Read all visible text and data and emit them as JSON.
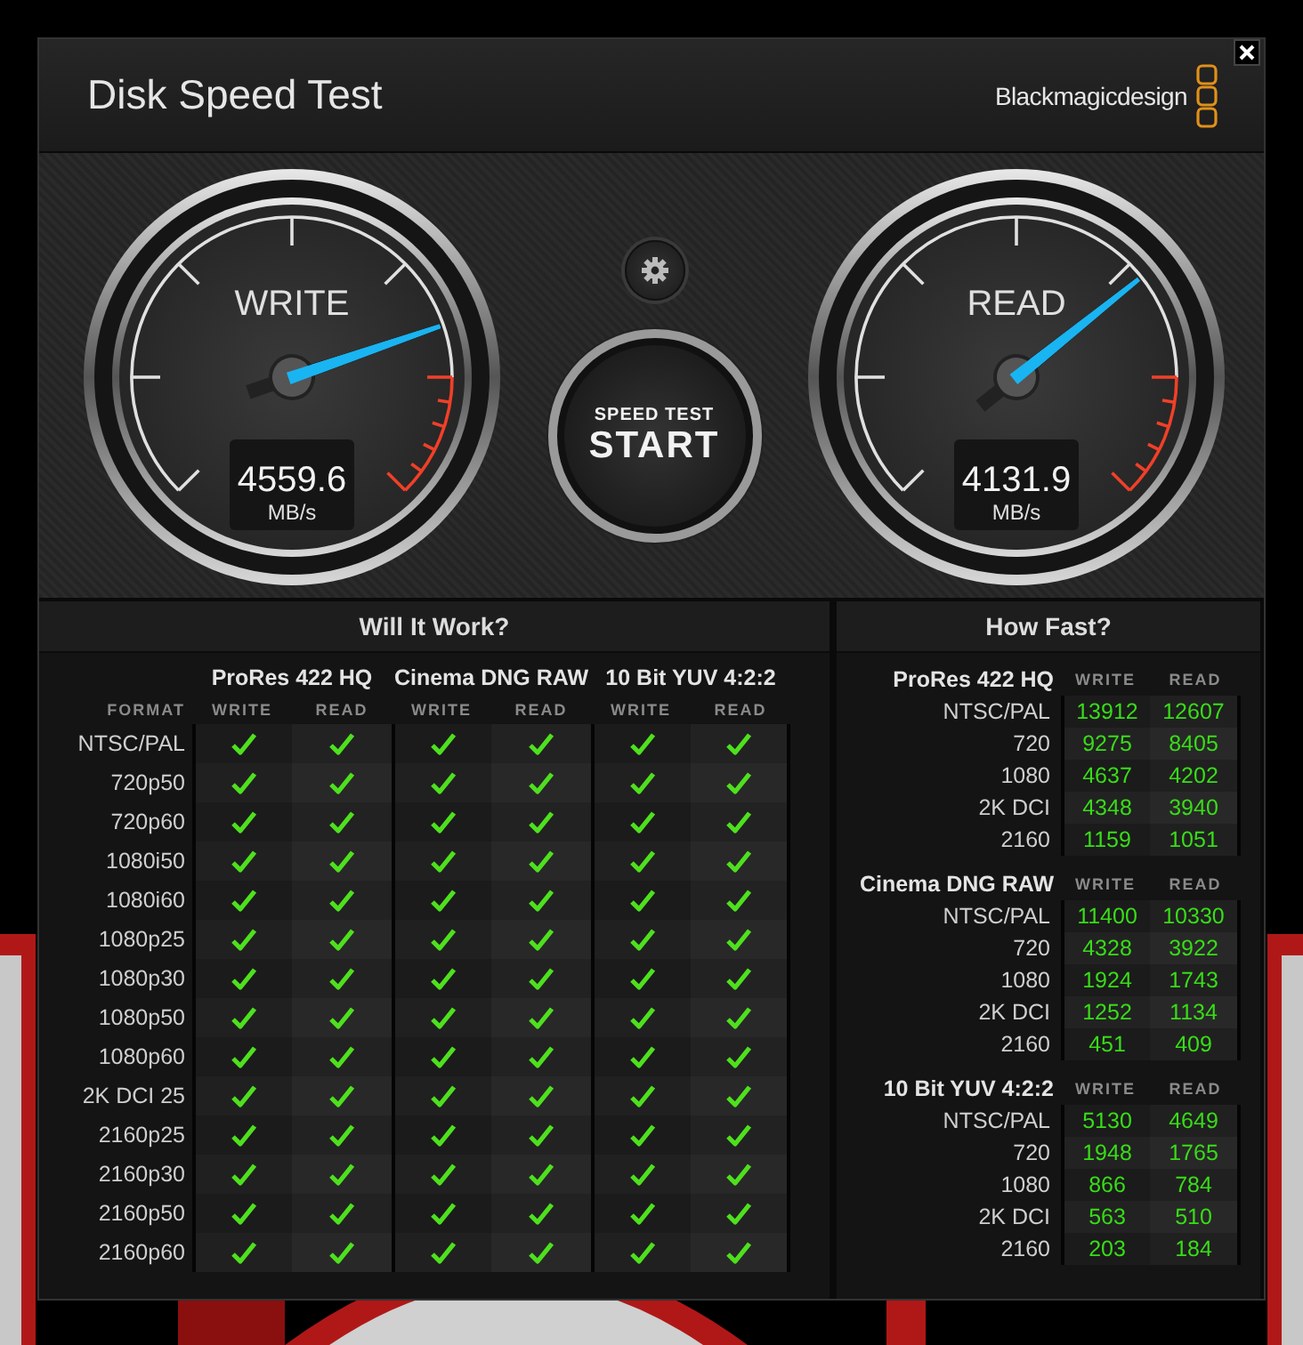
{
  "window": {
    "title": "Disk Speed Test",
    "brand": "Blackmagicdesign"
  },
  "gauges": [
    {
      "label": "WRITE",
      "value": "4559.6",
      "unit": "MB/s",
      "level": 0.763
    },
    {
      "label": "READ",
      "value": "4131.9",
      "unit": "MB/s",
      "level": 0.69
    }
  ],
  "start_button": {
    "caption": "SPEED TEST",
    "label": "START"
  },
  "will_it_work": {
    "title": "Will It Work?",
    "format_label": "FORMAT",
    "groups": [
      {
        "name": "ProRes 422 HQ",
        "columns": [
          "WRITE",
          "READ"
        ]
      },
      {
        "name": "Cinema DNG RAW",
        "columns": [
          "WRITE",
          "READ"
        ]
      },
      {
        "name": "10 Bit YUV 4:2:2",
        "columns": [
          "WRITE",
          "READ"
        ]
      }
    ],
    "rows": [
      {
        "format": "NTSC/PAL",
        "results": [
          {
            "checked": true
          },
          {
            "checked": true
          },
          {
            "checked": true
          },
          {
            "checked": true
          },
          {
            "checked": true
          },
          {
            "checked": true
          }
        ]
      },
      {
        "format": "720p50",
        "results": [
          {
            "checked": true
          },
          {
            "checked": true
          },
          {
            "checked": true
          },
          {
            "checked": true
          },
          {
            "checked": true
          },
          {
            "checked": true
          }
        ]
      },
      {
        "format": "720p60",
        "results": [
          {
            "checked": true
          },
          {
            "checked": true
          },
          {
            "checked": true
          },
          {
            "checked": true
          },
          {
            "checked": true
          },
          {
            "checked": true
          }
        ]
      },
      {
        "format": "1080i50",
        "results": [
          {
            "checked": true
          },
          {
            "checked": true
          },
          {
            "checked": true
          },
          {
            "checked": true
          },
          {
            "checked": true
          },
          {
            "checked": true
          }
        ]
      },
      {
        "format": "1080i60",
        "results": [
          {
            "checked": true
          },
          {
            "checked": true
          },
          {
            "checked": true
          },
          {
            "checked": true
          },
          {
            "checked": true
          },
          {
            "checked": true
          }
        ]
      },
      {
        "format": "1080p25",
        "results": [
          {
            "checked": true
          },
          {
            "checked": true
          },
          {
            "checked": true
          },
          {
            "checked": true
          },
          {
            "checked": true
          },
          {
            "checked": true
          }
        ]
      },
      {
        "format": "1080p30",
        "results": [
          {
            "checked": true
          },
          {
            "checked": true
          },
          {
            "checked": true
          },
          {
            "checked": true
          },
          {
            "checked": true
          },
          {
            "checked": true
          }
        ]
      },
      {
        "format": "1080p50",
        "results": [
          {
            "checked": true
          },
          {
            "checked": true
          },
          {
            "checked": true
          },
          {
            "checked": true
          },
          {
            "checked": true
          },
          {
            "checked": true
          }
        ]
      },
      {
        "format": "1080p60",
        "results": [
          {
            "checked": true
          },
          {
            "checked": true
          },
          {
            "checked": true
          },
          {
            "checked": true
          },
          {
            "checked": true
          },
          {
            "checked": true
          }
        ]
      },
      {
        "format": "2K DCI 25",
        "results": [
          {
            "checked": true
          },
          {
            "checked": true
          },
          {
            "checked": true
          },
          {
            "checked": true
          },
          {
            "checked": true
          },
          {
            "checked": true
          }
        ]
      },
      {
        "format": "2160p25",
        "results": [
          {
            "checked": true
          },
          {
            "checked": true
          },
          {
            "checked": true
          },
          {
            "checked": true
          },
          {
            "checked": true
          },
          {
            "checked": true
          }
        ]
      },
      {
        "format": "2160p30",
        "results": [
          {
            "checked": true
          },
          {
            "checked": true
          },
          {
            "checked": true
          },
          {
            "checked": true
          },
          {
            "checked": true
          },
          {
            "checked": true
          }
        ]
      },
      {
        "format": "2160p50",
        "results": [
          {
            "checked": true
          },
          {
            "checked": true
          },
          {
            "checked": true
          },
          {
            "checked": true
          },
          {
            "checked": true
          },
          {
            "checked": true
          }
        ]
      },
      {
        "format": "2160p60",
        "results": [
          {
            "checked": true
          },
          {
            "checked": true
          },
          {
            "checked": true
          },
          {
            "checked": true
          },
          {
            "checked": true
          },
          {
            "checked": true
          }
        ]
      }
    ]
  },
  "how_fast": {
    "title": "How Fast?",
    "sections": [
      {
        "codec": "ProRes 422 HQ",
        "write_label": "WRITE",
        "read_label": "READ",
        "rows": [
          {
            "resolution": "NTSC/PAL",
            "write": "13912",
            "read": "12607"
          },
          {
            "resolution": "720",
            "write": "9275",
            "read": "8405"
          },
          {
            "resolution": "1080",
            "write": "4637",
            "read": "4202"
          },
          {
            "resolution": "2K DCI",
            "write": "4348",
            "read": "3940"
          },
          {
            "resolution": "2160",
            "write": "1159",
            "read": "1051"
          }
        ]
      },
      {
        "codec": "Cinema DNG RAW",
        "write_label": "WRITE",
        "read_label": "READ",
        "rows": [
          {
            "resolution": "NTSC/PAL",
            "write": "11400",
            "read": "10330"
          },
          {
            "resolution": "720",
            "write": "4328",
            "read": "3922"
          },
          {
            "resolution": "1080",
            "write": "1924",
            "read": "1743"
          },
          {
            "resolution": "2K DCI",
            "write": "1252",
            "read": "1134"
          },
          {
            "resolution": "2160",
            "write": "451",
            "read": "409"
          }
        ]
      },
      {
        "codec": "10 Bit YUV 4:2:2",
        "write_label": "WRITE",
        "read_label": "READ",
        "rows": [
          {
            "resolution": "NTSC/PAL",
            "write": "5130",
            "read": "4649"
          },
          {
            "resolution": "720",
            "write": "1948",
            "read": "1765"
          },
          {
            "resolution": "1080",
            "write": "866",
            "read": "784"
          },
          {
            "resolution": "2K DCI",
            "write": "563",
            "read": "510"
          },
          {
            "resolution": "2160",
            "write": "203",
            "read": "184"
          }
        ]
      }
    ]
  }
}
